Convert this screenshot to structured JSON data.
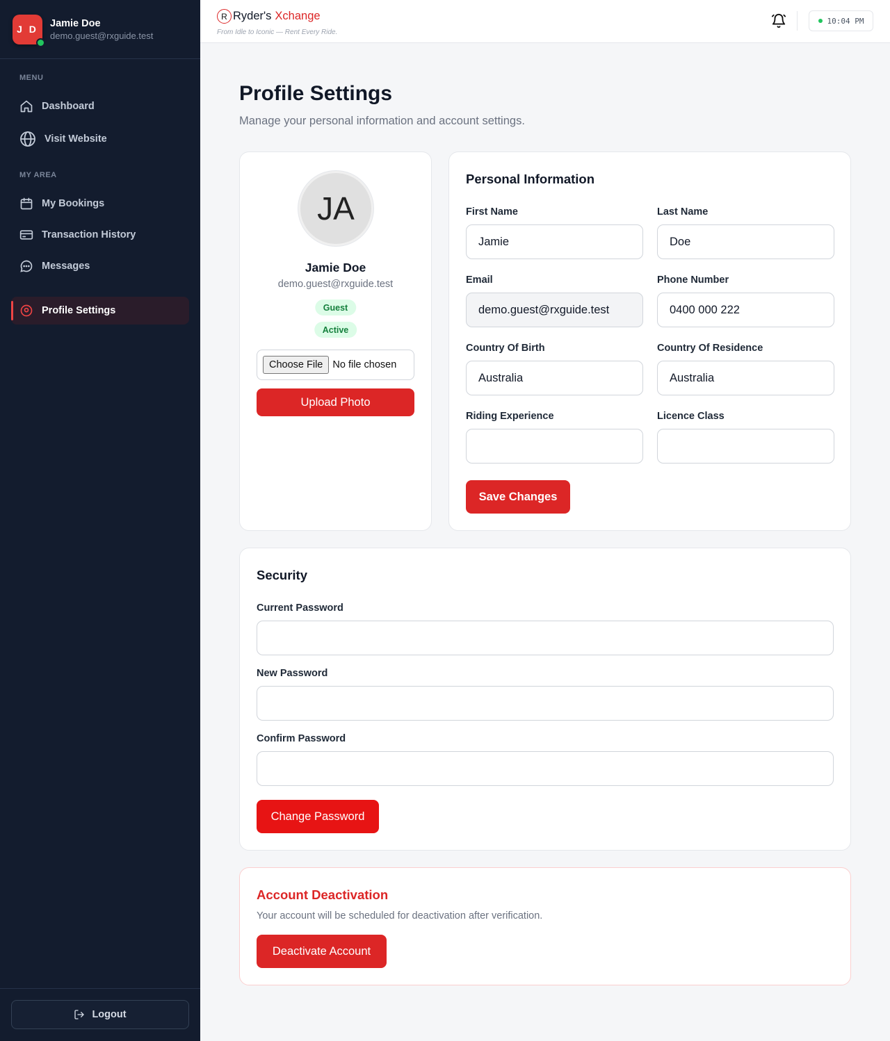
{
  "sidebar": {
    "user": {
      "initials": "J D",
      "name": "Jamie Doe",
      "email": "demo.guest@rxguide.test"
    },
    "menu_heading": "MENU",
    "menu_items": [
      {
        "label": "Dashboard",
        "icon": "home-icon"
      },
      {
        "label": "Visit Website",
        "icon": "globe-icon"
      }
    ],
    "area_heading": "MY AREA",
    "area_items": [
      {
        "label": "My Bookings",
        "icon": "calendar-icon"
      },
      {
        "label": "Transaction History",
        "icon": "credit-card-icon"
      },
      {
        "label": "Messages",
        "icon": "chat-icon"
      }
    ],
    "active_item": {
      "label": "Profile Settings",
      "icon": "profile-circle-icon"
    },
    "logout_label": "Logout"
  },
  "topbar": {
    "brand_r": "R",
    "brand_name": "Ryder's",
    "brand_accent": "Xchange",
    "tagline": "From Idle to Iconic — Rent Every Ride.",
    "clock": "10:04 PM"
  },
  "page": {
    "title": "Profile Settings",
    "subtitle": "Manage your personal information and account settings."
  },
  "profile_card": {
    "avatar_initials": "JA",
    "name": "Jamie Doe",
    "email": "demo.guest@rxguide.test",
    "role_badge": "Guest",
    "status_badge": "Active",
    "file_button": "Choose File",
    "file_status": "No file chosen",
    "upload_label": "Upload Photo"
  },
  "personal": {
    "heading": "Personal Information",
    "first_name_label": "First Name",
    "first_name": "Jamie",
    "last_name_label": "Last Name",
    "last_name": "Doe",
    "email_label": "Email",
    "email": "demo.guest@rxguide.test",
    "phone_label": "Phone Number",
    "phone": "0400 000 222",
    "birth_label": "Country Of Birth",
    "birth": "Australia",
    "residence_label": "Country Of Residence",
    "residence": "Australia",
    "riding_label": "Riding Experience",
    "riding": "",
    "licence_label": "Licence Class",
    "licence": "",
    "save_label": "Save Changes"
  },
  "security": {
    "heading": "Security",
    "current_label": "Current Password",
    "new_label": "New Password",
    "confirm_label": "Confirm Password",
    "change_label": "Change Password"
  },
  "deactivation": {
    "heading": "Account Deactivation",
    "text": "Your account will be scheduled for deactivation after verification.",
    "button_label": "Deactivate Account"
  },
  "colors": {
    "sidebar_bg": "#131c2e",
    "accent_red": "#dc2626",
    "online_green": "#22c55e"
  }
}
